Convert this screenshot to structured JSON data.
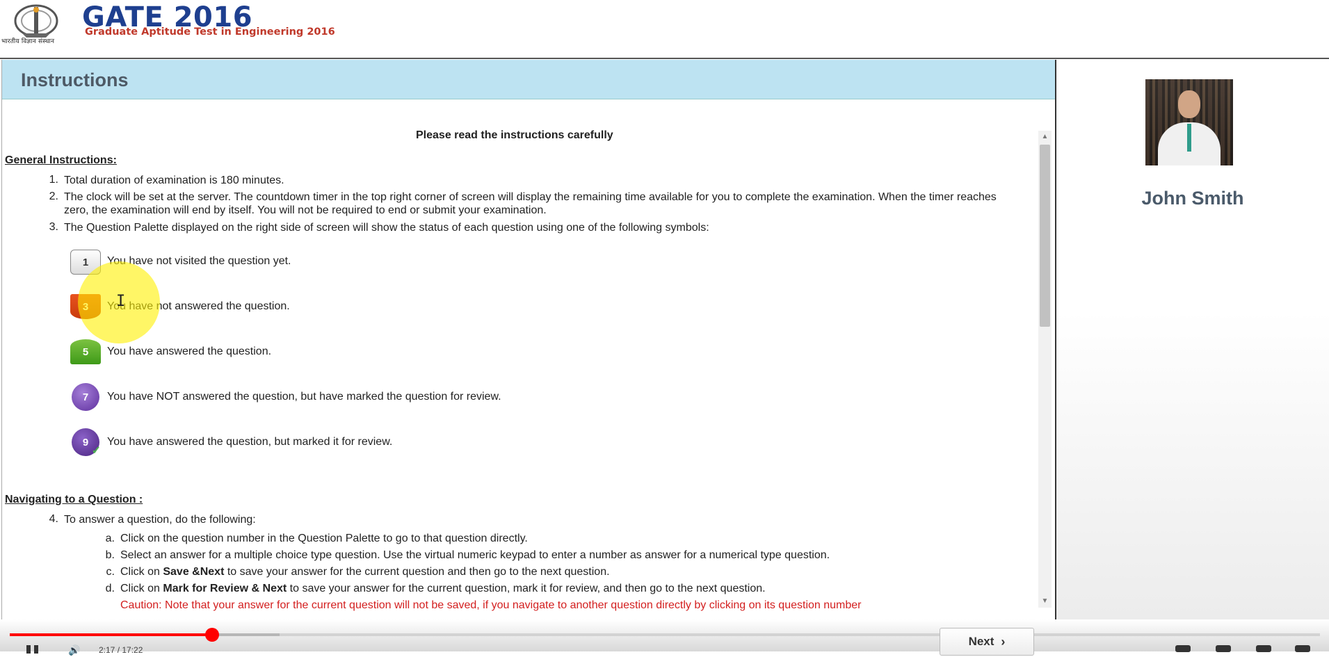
{
  "header": {
    "logo_caption": "भारतीय विज्ञान संस्थान",
    "title": "GATE 2016",
    "subtitle": "Graduate Aptitude Test in Engineering 2016"
  },
  "instructions": {
    "panel_title": "Instructions",
    "read_carefully": "Please read the instructions carefully",
    "general_heading": "General Instructions:",
    "general_items": [
      {
        "num": "1.",
        "text": "Total duration of examination is 180 minutes."
      },
      {
        "num": "2.",
        "text": "The clock will be set at the server. The countdown timer in the top right corner of screen will display the remaining time available for you to complete the examination. When the timer reaches zero, the examination will end by itself. You will not be required to end or submit your examination."
      },
      {
        "num": "3.",
        "text": "The Question Palette displayed on the right side of screen will show the status of each question using one of the following symbols:"
      }
    ],
    "legend": [
      {
        "symbol": "1",
        "text": "You have not visited the question yet."
      },
      {
        "symbol": "3",
        "text": "You have not answered the question."
      },
      {
        "symbol": "5",
        "text": "You have answered the question."
      },
      {
        "symbol": "7",
        "text": "You have NOT answered the question, but have marked the question for review."
      },
      {
        "symbol": "9",
        "text": "You have answered the question, but marked it for review."
      }
    ],
    "nav_heading": "Navigating to a Question :",
    "nav_item": {
      "num": "4.",
      "text": "To answer a question, do the following:"
    },
    "nav_subitems": [
      {
        "letter": "a.",
        "pre": "Click on the question number in the Question Palette to go to that question directly.",
        "bold": "",
        "post": ""
      },
      {
        "letter": "b.",
        "pre": "Select an answer for a multiple choice type question. Use the virtual numeric keypad to enter a number as answer for a numerical type question.",
        "bold": "",
        "post": ""
      },
      {
        "letter": "c.",
        "pre": "Click on ",
        "bold": "Save &Next",
        "post": " to save your answer for the current question and then go to the next question."
      },
      {
        "letter": "d.",
        "pre": "Click on ",
        "bold": "Mark for Review & Next",
        "post": " to save your answer for the current question, mark it for review, and then go to the next question."
      }
    ],
    "caution_text": "Caution: Note that your answer for the current question will not be saved, if you navigate to another question directly by clicking on its question number"
  },
  "profile": {
    "name": "John Smith"
  },
  "player": {
    "progress_fraction": 0.1545,
    "time_text": "2:17 / 17:22",
    "next_label": "Next"
  },
  "colors": {
    "accent_header": "#bde3f2",
    "gate_blue": "#1e3f8f",
    "gate_red": "#c0392b",
    "progress_red": "#ff0000",
    "caution_red": "#d31f1f"
  },
  "icons": {
    "logo": "iisc-emblem-icon",
    "cursor": "text-cursor-icon",
    "next": "chevron-right-icon",
    "pause": "pause-icon",
    "volume": "volume-icon"
  }
}
